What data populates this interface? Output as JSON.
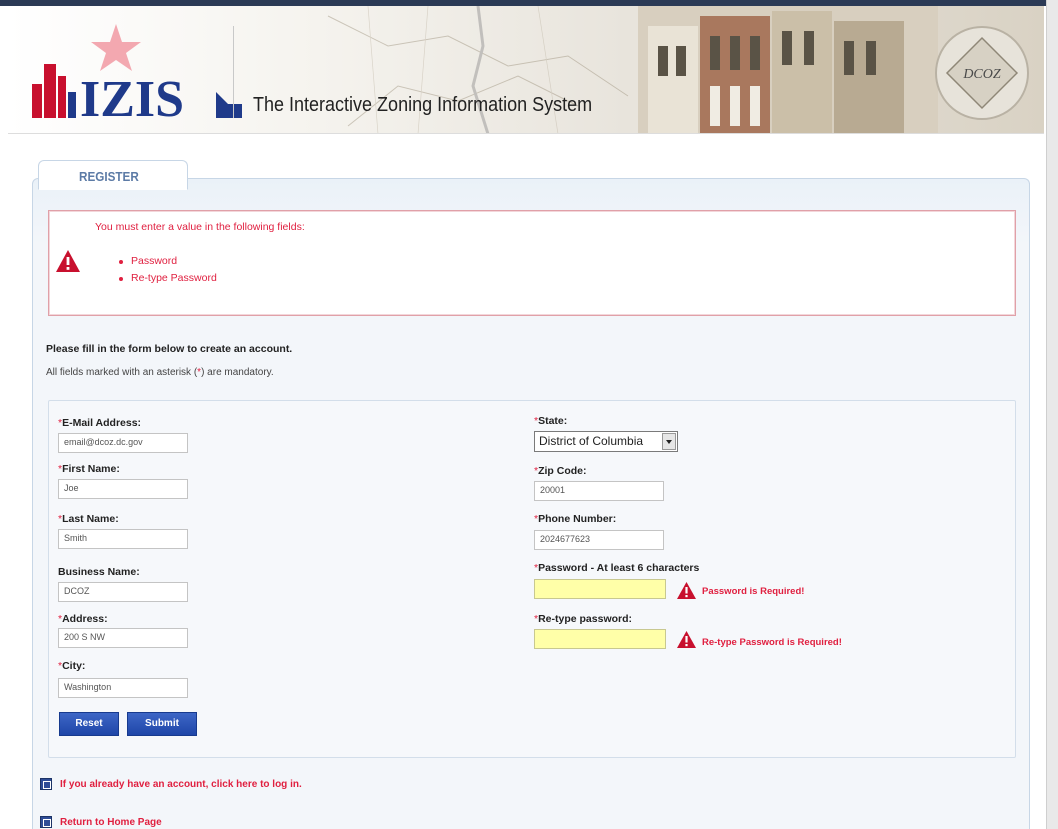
{
  "header": {
    "logo_text": "IZIS",
    "title": "The Interactive Zoning Information System",
    "seal_text": "DCOZ"
  },
  "tab": {
    "label": "REGISTER"
  },
  "errors": {
    "title": "You must enter a value in the following fields:",
    "items": [
      "Password",
      "Re-type Password"
    ]
  },
  "intro": {
    "line1": "Please fill in the form below to create an account.",
    "line2_pre": "All fields marked with an asterisk (",
    "line2_ast": "*",
    "line2_post": ") are mandatory."
  },
  "form": {
    "email": {
      "label": "E-Mail Address:",
      "value": "email@dcoz.dc.gov"
    },
    "first_name": {
      "label": "First Name:",
      "value": "Joe"
    },
    "last_name": {
      "label": "Last Name:",
      "value": "Smith"
    },
    "business_name": {
      "label": "Business Name:",
      "value": "DCOZ"
    },
    "address": {
      "label": "Address:",
      "value": "200 S NW"
    },
    "city": {
      "label": "City:",
      "value": "Washington"
    },
    "state": {
      "label": "State:",
      "value": "District of Columbia"
    },
    "zip": {
      "label": "Zip Code:",
      "value": "20001"
    },
    "phone": {
      "label": "Phone Number:",
      "value": "2024677623"
    },
    "password": {
      "label": "Password - At least 6 characters",
      "value": "",
      "error": "Password is Required!"
    },
    "retype_password": {
      "label": "Re-type password:",
      "value": "",
      "error": "Re-type Password is Required!"
    },
    "required_marker": "*",
    "reset_label": "Reset",
    "submit_label": "Submit"
  },
  "links": {
    "login": "If you already have an account, click here to log in.",
    "home": "Return to Home Page"
  },
  "colors": {
    "error_red": "#e02040",
    "button_blue": "#2b52b5",
    "tab_text": "#5c7ba6"
  }
}
